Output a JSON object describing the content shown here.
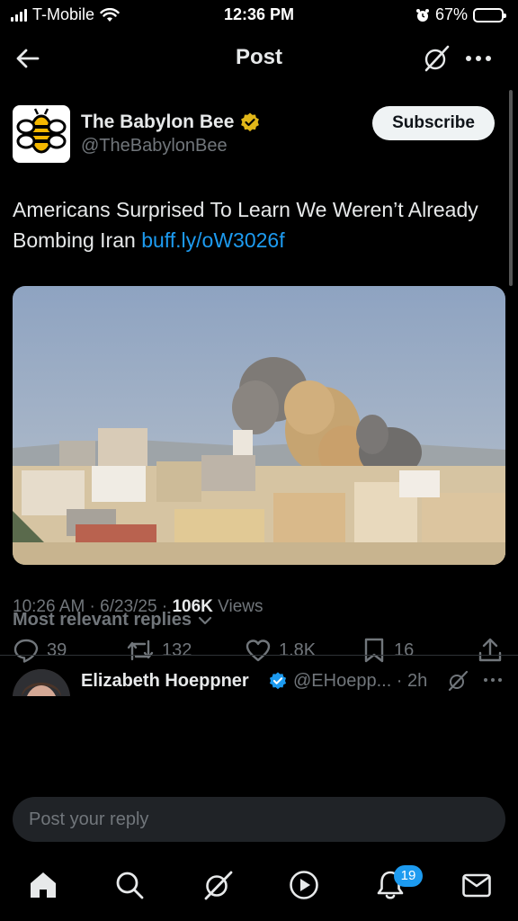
{
  "status_bar": {
    "carrier": "T-Mobile",
    "time": "12:36 PM",
    "battery_percent": "67%",
    "battery_level": 0.67
  },
  "header": {
    "title": "Post",
    "icons": [
      "back-arrow-icon",
      "grok-icon",
      "more-icon"
    ]
  },
  "post": {
    "author_name": "The Babylon Bee",
    "author_handle": "@TheBabylonBee",
    "subscribe_label": "Subscribe",
    "text": "Americans Surprised To Learn We Weren’t Already Bombing Iran",
    "link_text": "buff.ly/oW3026f",
    "timestamp": "10:26 AM · 6/23/25 · ",
    "views_count": "106K",
    "views_label": "Views",
    "stats": {
      "replies": "39",
      "reposts": "132",
      "likes": "1.8K",
      "bookmarks": "16"
    }
  },
  "replies_section": {
    "sort_label": "Most relevant replies"
  },
  "reply_preview": {
    "name": "Elizabeth Hoeppner",
    "handle_time": "@EHoepp... · 2h"
  },
  "composer": {
    "placeholder": "Post your reply"
  },
  "tab_bar": {
    "notifications_badge": "19",
    "tabs": [
      "home-icon",
      "search-icon",
      "grok-icon",
      "video-icon",
      "notifications-icon",
      "messages-icon"
    ]
  },
  "colors": {
    "accent": "#1d9bf0",
    "text_primary": "#e7e9ea",
    "text_secondary": "#71767b",
    "verified_gold": "#e2b719"
  }
}
